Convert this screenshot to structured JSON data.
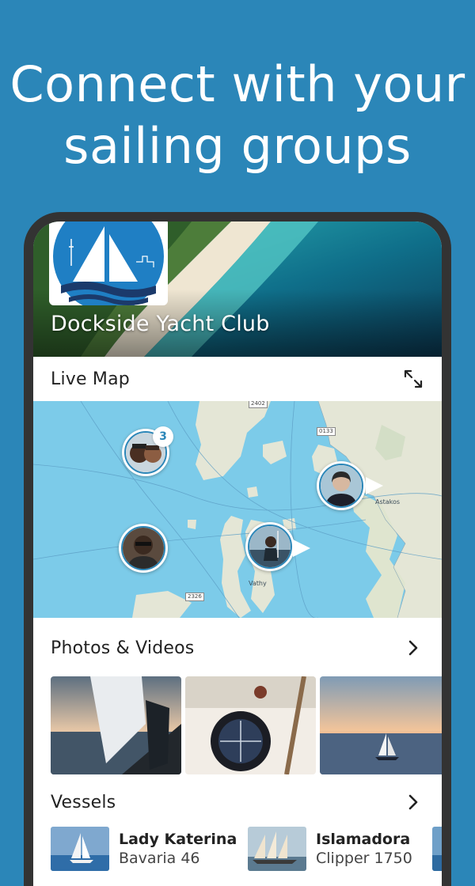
{
  "headline": {
    "line1": "Connect with your",
    "line2": "sailing groups"
  },
  "club": {
    "name": "Dockside Yacht Club"
  },
  "live_map": {
    "title": "Live Map",
    "cluster_count": "3",
    "place_labels": [
      "Astakos",
      "Vathy"
    ],
    "road_labels": [
      "2402",
      "0133",
      "2326"
    ]
  },
  "photos": {
    "title": "Photos & Videos"
  },
  "vessels": {
    "title": "Vessels",
    "items": [
      {
        "name": "Lady Katerina",
        "model": "Bavaria 46"
      },
      {
        "name": "Islamadora",
        "model": "Clipper 1750"
      }
    ]
  },
  "colors": {
    "background": "#2b86b8",
    "accent": "#2b86b8",
    "sea": "#7ccbe9",
    "land": "#e4e6d6"
  },
  "icons": {
    "expand": "expand-icon",
    "chevron": "chevron-right-icon"
  }
}
